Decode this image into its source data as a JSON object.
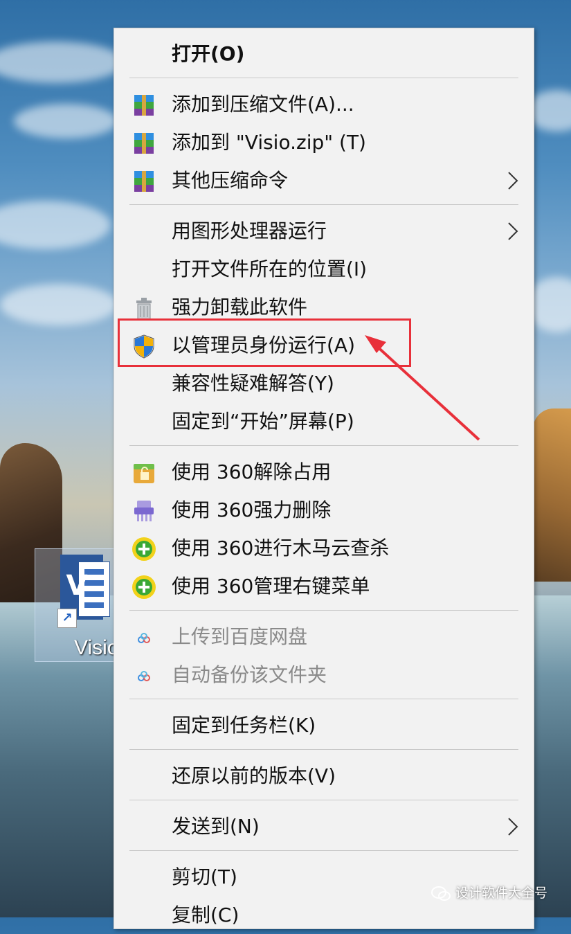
{
  "desktop": {
    "shortcut_label": "Visio"
  },
  "context_menu": {
    "items": [
      {
        "label": "打开(O)",
        "icon": "none",
        "submenu": false
      },
      {
        "label": "添加到压缩文件(A)...",
        "icon": "winrar-icon",
        "submenu": false
      },
      {
        "label": "添加到 \"Visio.zip\" (T)",
        "icon": "winrar-icon",
        "submenu": false
      },
      {
        "label": "其他压缩命令",
        "icon": "winrar-icon",
        "submenu": true
      },
      {
        "label": "用图形处理器运行",
        "icon": "none",
        "submenu": true
      },
      {
        "label": "打开文件所在的位置(I)",
        "icon": "none",
        "submenu": false
      },
      {
        "label": "强力卸载此软件",
        "icon": "trash-can-icon",
        "submenu": false
      },
      {
        "label": "以管理员身份运行(A)",
        "icon": "uac-shield-icon",
        "submenu": false
      },
      {
        "label": "兼容性疑难解答(Y)",
        "icon": "none",
        "submenu": false
      },
      {
        "label": "固定到“开始”屏幕(P)",
        "icon": "none",
        "submenu": false
      },
      {
        "label": "使用 360解除占用",
        "icon": "360-unlock-icon",
        "submenu": false
      },
      {
        "label": "使用 360强力删除",
        "icon": "360-shredder-icon",
        "submenu": false
      },
      {
        "label": "使用 360进行木马云查杀",
        "icon": "360-scan-icon",
        "submenu": false
      },
      {
        "label": "使用 360管理右键菜单",
        "icon": "360-menu-icon",
        "submenu": false
      },
      {
        "label": "上传到百度网盘",
        "icon": "baidu-cloud-icon",
        "submenu": false,
        "disabled": true
      },
      {
        "label": "自动备份该文件夹",
        "icon": "baidu-cloud-icon",
        "submenu": false,
        "disabled": true
      },
      {
        "label": "固定到任务栏(K)",
        "icon": "none",
        "submenu": false
      },
      {
        "label": "还原以前的版本(V)",
        "icon": "none",
        "submenu": false
      },
      {
        "label": "发送到(N)",
        "icon": "none",
        "submenu": true
      },
      {
        "label": "剪切(T)",
        "icon": "none",
        "submenu": false
      },
      {
        "label": "复制(C)",
        "icon": "none",
        "submenu": false
      }
    ],
    "highlighted_item": "以管理员身份运行(A)",
    "highlight_color": "#e8303a"
  },
  "watermark": {
    "text": "设计软件大全号"
  }
}
